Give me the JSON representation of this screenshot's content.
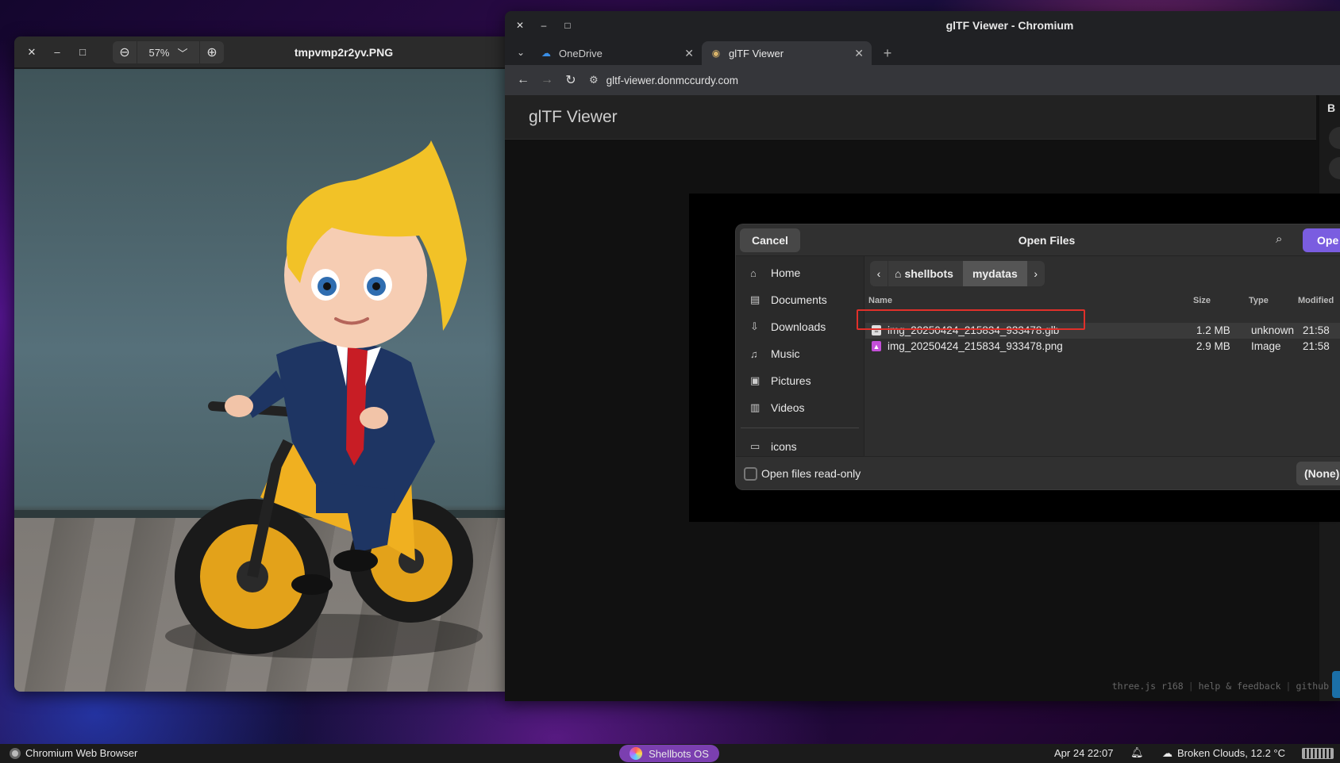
{
  "viewer": {
    "title": "tmpvmp2r2yv.PNG",
    "zoom": "57%",
    "close_glyph": "✕",
    "minimize_glyph": "–",
    "maximize_glyph": "□",
    "zoom_out_glyph": "⊖",
    "zoom_in_glyph": "⊕",
    "zoom_menu_glyph": "﹀"
  },
  "browser": {
    "window_title": "glTF Viewer - Chromium",
    "tabs": [
      {
        "label": "OneDrive",
        "icon": "onedrive-icon",
        "active": false
      },
      {
        "label": "glTF Viewer",
        "icon": "gltf-favicon",
        "active": true
      }
    ],
    "close_glyph": "✕",
    "new_tab_glyph": "+",
    "url": "gltf-viewer.donmccurdy.com",
    "page": {
      "app_title": "glTF Viewer",
      "side_label": "B",
      "footer": [
        "three.js r168",
        "help & feedback",
        "github"
      ]
    }
  },
  "dialog": {
    "title": "Open Files",
    "cancel_label": "Cancel",
    "open_label": "Ope",
    "places": [
      {
        "label": "Home",
        "icon": "home-icon",
        "glyph": "⌂"
      },
      {
        "label": "Documents",
        "icon": "documents-icon",
        "glyph": "▤"
      },
      {
        "label": "Downloads",
        "icon": "downloads-icon",
        "glyph": "⇩"
      },
      {
        "label": "Music",
        "icon": "music-icon",
        "glyph": "♫"
      },
      {
        "label": "Pictures",
        "icon": "pictures-icon",
        "glyph": "▣"
      },
      {
        "label": "Videos",
        "icon": "videos-icon",
        "glyph": "▥"
      }
    ],
    "bookmarks": [
      {
        "label": "icons",
        "icon": "folder-icon",
        "glyph": "▭"
      }
    ],
    "path": {
      "home": "shellbots",
      "current": "mydatas"
    },
    "columns": {
      "name": "Name",
      "size": "Size",
      "type": "Type",
      "modified": "Modified"
    },
    "files": [
      {
        "name": "img_20250424_215834_933478.glb",
        "size": "1.2 MB",
        "type": "unknown",
        "modified": "21:58",
        "icon": "document-file-icon",
        "selected": true
      },
      {
        "name": "img_20250424_215834_933478.png",
        "size": "2.9 MB",
        "type": "Image",
        "modified": "21:58",
        "icon": "image-file-icon",
        "selected": false
      }
    ],
    "readonly_label": "Open files read-only",
    "filter_label": "(None)"
  },
  "taskbar": {
    "active_app": "Chromium Web Browser",
    "os_label": "Shellbots OS",
    "clock": "Apr 24  22:07",
    "weather": "Broken Clouds, 12.2 °C"
  }
}
